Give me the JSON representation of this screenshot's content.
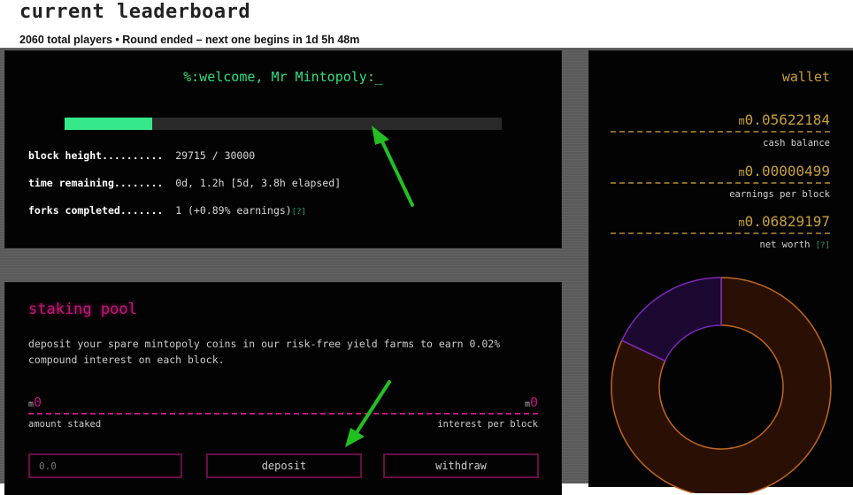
{
  "header": {
    "title": "current leaderboard",
    "subtitle": "2060 total players • Round ended – next one begins in 1d 5h 48m"
  },
  "welcome": {
    "text": "%:welcome, Mr Mintopoly:_",
    "progress": 0.2
  },
  "stats": [
    {
      "label": "block height..........",
      "value": "29715 / 30000",
      "help": ""
    },
    {
      "label": "time remaining........",
      "value": "0d, 1.2h [5d, 3.8h elapsed]",
      "help": ""
    },
    {
      "label": "forks completed.......",
      "value": "1 (+0.89% earnings)",
      "help": "[?]"
    }
  ],
  "staking": {
    "title": "staking pool",
    "description": "deposit your spare mintopoly coins in our risk-free yield farms to earn 0.02% compound interest on each block.",
    "currency": "m",
    "amount_staked": "0",
    "interest_per_block": "0",
    "amount_label": "amount staked",
    "interest_label": "interest per block",
    "input_placeholder": "0.0",
    "deposit_label": "deposit",
    "withdraw_label": "withdraw"
  },
  "wallet": {
    "title": "wallet",
    "currency": "m",
    "cash_balance": "0.05622184",
    "cash_label": "cash balance",
    "earnings": "0.00000499",
    "earnings_label": "earnings per block",
    "net_worth": "0.06829197",
    "net_worth_label": "net worth",
    "help": "[?]",
    "donut": {
      "slices": [
        {
          "share": 0.82,
          "color": "#2a1004",
          "stroke": "#c0661e"
        },
        {
          "share": 0.18,
          "color": "#1c0830",
          "stroke": "#7a2ab8"
        }
      ]
    }
  },
  "colors": {
    "green": "#2fe07f",
    "pink": "#c0157a",
    "gold": "#c8a03a",
    "annotation_arrow": "#22c022"
  }
}
